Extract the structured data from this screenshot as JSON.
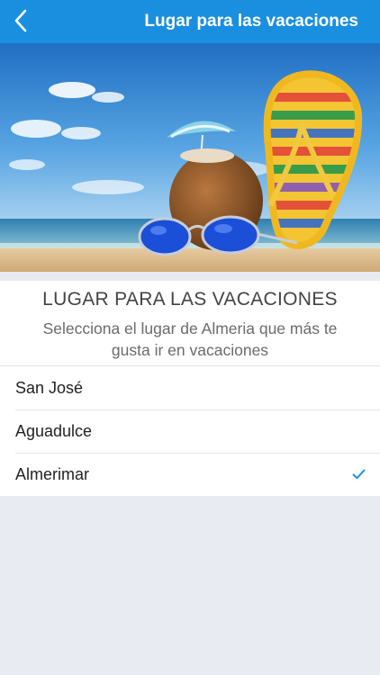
{
  "navbar": {
    "title": "Lugar para las vacaciones",
    "back_icon": "chevron-left-icon",
    "color": "#1a8fe0"
  },
  "hero": {
    "image": "beach-vacation-photo"
  },
  "section": {
    "heading": "LUGAR PARA LAS VACACIONES",
    "subtitle": "Selecciona el lugar de Almeria que más te gusta ir en vacaciones"
  },
  "options": [
    {
      "label": "San José",
      "selected": false
    },
    {
      "label": "Aguadulce",
      "selected": false
    },
    {
      "label": "Almerimar",
      "selected": true
    }
  ],
  "check_icon": "checkmark-icon",
  "accent": "#1a8fe0"
}
